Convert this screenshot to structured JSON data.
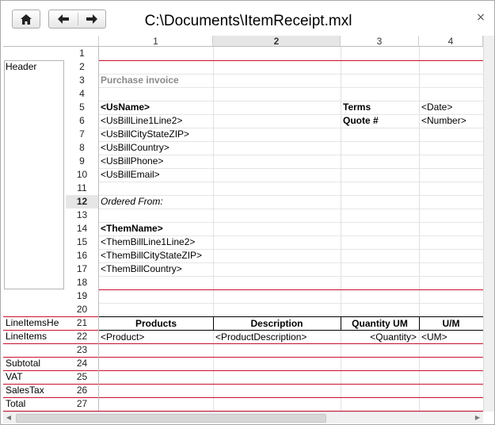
{
  "window": {
    "title": "C:\\Documents\\ItemReceipt.mxl",
    "close_glyph": "×"
  },
  "toolbar": {
    "home_icon": "home-icon",
    "back_icon": "arrow-left-icon",
    "forward_icon": "arrow-right-icon"
  },
  "columns": [
    "1",
    "2",
    "3",
    "4"
  ],
  "selected_column": "2",
  "selected_row": "12",
  "rows": [
    "1",
    "2",
    "3",
    "4",
    "5",
    "6",
    "7",
    "8",
    "9",
    "10",
    "11",
    "12",
    "13",
    "14",
    "15",
    "16",
    "17",
    "18",
    "19",
    "20",
    "21",
    "22",
    "23",
    "24",
    "25",
    "26",
    "27"
  ],
  "groups": {
    "header": "Header",
    "line_items_header": "LineItemsHe",
    "line_items": "LineItems",
    "subtotal": "Subtotal",
    "vat": "VAT",
    "sales_tax": "SalesTax",
    "total": "Total"
  },
  "cells": {
    "purchase_invoice": "Purchase invoice",
    "us_name": "<UsName>",
    "terms": "Terms",
    "date": "<Date>",
    "us_bill_line": "<UsBillLine1Line2>",
    "quote_no": "Quote #",
    "number": "<Number>",
    "us_bill_city": "<UsBillCityStateZIP>",
    "us_bill_country": "<UsBillCountry>",
    "us_bill_phone": "<UsBillPhone>",
    "us_bill_email": "<UsBillEmail>",
    "ordered_from": "Ordered From:",
    "them_name": "<ThemName>",
    "them_bill_line": "<ThemBillLine1Line2>",
    "them_bill_city": "<ThemBillCityStateZIP>",
    "them_bill_country": "<ThemBillCountry>",
    "products_hdr": "Products",
    "description_hdr": "Description",
    "quantity_hdr": "Quantity UM",
    "um_hdr": "U/M",
    "product": "<Product>",
    "product_description": "<ProductDescription>",
    "quantity": "<Quantity>",
    "um": "<UM>"
  },
  "colors": {
    "accent_red": "#c8102e",
    "selected_header": "#e6e6e6"
  }
}
